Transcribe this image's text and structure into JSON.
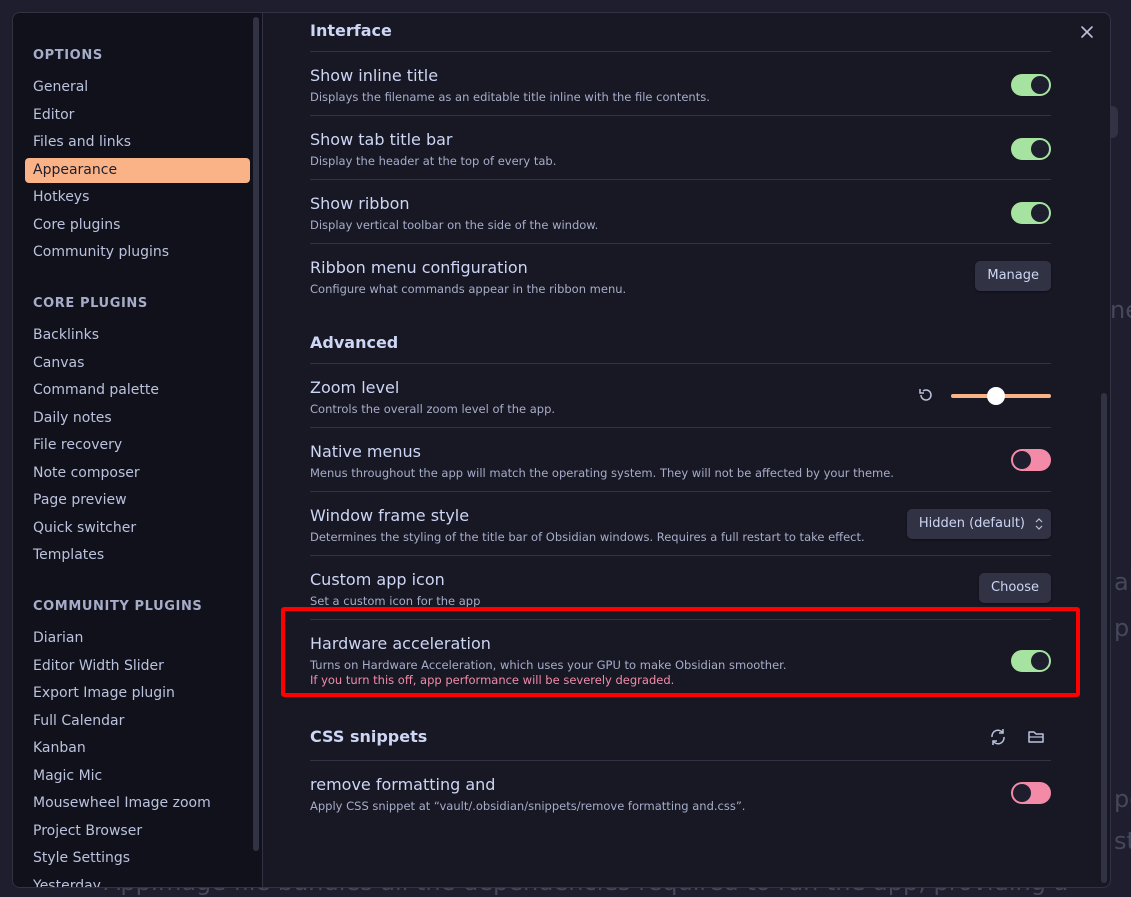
{
  "background": {
    "fragments": [
      "ne",
      "ak",
      "pu",
      "pe",
      "st"
    ],
    "bottom_line": "AppImage file bundles all the dependencies required to run the app, providing a"
  },
  "sidebar": {
    "options_header": "OPTIONS",
    "options": [
      "General",
      "Editor",
      "Files and links",
      "Appearance",
      "Hotkeys",
      "Core plugins",
      "Community plugins"
    ],
    "active": "Appearance",
    "core_header": "CORE PLUGINS",
    "core": [
      "Backlinks",
      "Canvas",
      "Command palette",
      "Daily notes",
      "File recovery",
      "Note composer",
      "Page preview",
      "Quick switcher",
      "Templates"
    ],
    "community_header": "COMMUNITY PLUGINS",
    "community": [
      "Diarian",
      "Editor Width Slider",
      "Export Image plugin",
      "Full Calendar",
      "Kanban",
      "Magic Mic",
      "Mousewheel Image zoom",
      "Project Browser",
      "Style Settings",
      "Yesterday"
    ]
  },
  "content": {
    "interface_heading": "Interface",
    "inline_title": {
      "name": "Show inline title",
      "desc": "Displays the filename as an editable title inline with the file contents.",
      "state": "on"
    },
    "tab_title_bar": {
      "name": "Show tab title bar",
      "desc": "Display the header at the top of every tab.",
      "state": "on"
    },
    "ribbon": {
      "name": "Show ribbon",
      "desc": "Display vertical toolbar on the side of the window.",
      "state": "on"
    },
    "ribbon_menu": {
      "name": "Ribbon menu configuration",
      "desc": "Configure what commands appear in the ribbon menu.",
      "button": "Manage"
    },
    "advanced_heading": "Advanced",
    "zoom": {
      "name": "Zoom level",
      "desc": "Controls the overall zoom level of the app.",
      "value_fraction": 0.45
    },
    "native_menus": {
      "name": "Native menus",
      "desc": "Menus throughout the app will match the operating system. They will not be affected by your theme.",
      "state": "off"
    },
    "window_frame": {
      "name": "Window frame style",
      "desc": "Determines the styling of the title bar of Obsidian windows. Requires a full restart to take effect.",
      "selected": "Hidden (default)"
    },
    "app_icon": {
      "name": "Custom app icon",
      "desc": "Set a custom icon for the app",
      "button": "Choose"
    },
    "hardware_accel": {
      "name": "Hardware acceleration",
      "desc": "Turns on Hardware Acceleration, which uses your GPU to make Obsidian smoother.",
      "warning": "If you turn this off, app performance will be severely degraded.",
      "state": "on"
    },
    "css_heading": "CSS snippets",
    "snippet": {
      "name": "remove formatting and",
      "desc": "Apply CSS snippet at “vault/.obsidian/snippets/remove formatting and.css”.",
      "state": "off"
    }
  },
  "colors": {
    "accent": "#fab387",
    "toggle_on": "#a6e3a1",
    "toggle_off": "#f38ba8",
    "highlight_box": "#ff0000"
  },
  "icons": {
    "close": "close-icon",
    "reset": "reset-icon",
    "reload": "reload-icon",
    "folder": "folder-icon",
    "select": "chevron-updown-icon"
  }
}
